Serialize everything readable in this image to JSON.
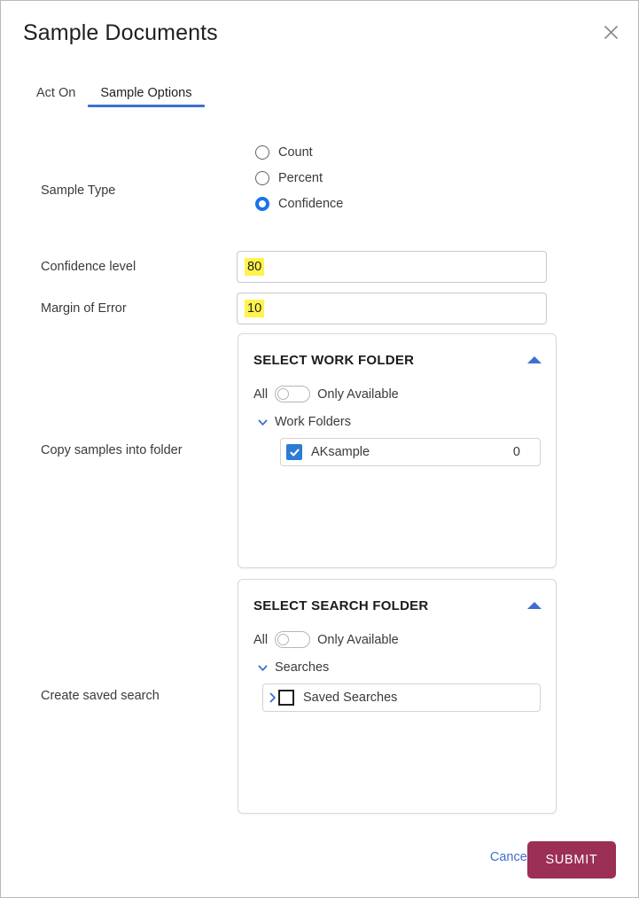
{
  "dialog": {
    "title": "Sample Documents",
    "close_icon": "close-icon"
  },
  "tabs": [
    {
      "label": "Act On",
      "active": false
    },
    {
      "label": "Sample Options",
      "active": true
    }
  ],
  "sample_type": {
    "label": "Sample Type",
    "options": [
      {
        "label": "Count",
        "selected": false
      },
      {
        "label": "Percent",
        "selected": false
      },
      {
        "label": "Confidence",
        "selected": true
      }
    ]
  },
  "confidence_level": {
    "label": "Confidence level",
    "value": "80"
  },
  "margin_of_error": {
    "label": "Margin of Error",
    "value": "10"
  },
  "work_folder": {
    "row_label": "Copy samples into folder",
    "panel_title": "SELECT WORK FOLDER",
    "collapse_icon": "caret-up-icon",
    "toggle_left_label": "All",
    "toggle_right_label": "Only Available",
    "toggle_state": "All",
    "tree_parent": "Work Folders",
    "tree_parent_icon": "chevron-down-icon",
    "child": {
      "label": "AKsample",
      "count": "0",
      "checked": true
    }
  },
  "search_folder": {
    "row_label": "Create saved search",
    "panel_title": "SELECT SEARCH FOLDER",
    "collapse_icon": "caret-up-icon",
    "toggle_left_label": "All",
    "toggle_right_label": "Only Available",
    "toggle_state": "All",
    "tree_parent": "Searches",
    "tree_parent_icon": "chevron-down-icon",
    "child": {
      "label": "Saved Searches",
      "expand_icon": "chevron-right-icon",
      "checked": false
    }
  },
  "footer": {
    "cancel_label": "Cancel",
    "submit_label": "SUBMIT"
  },
  "colors": {
    "accent_blue": "#3d6fd0",
    "checkbox_blue": "#2b7cd3",
    "radio_blue": "#1a73e8",
    "submit_maroon": "#9b2f55",
    "highlight_yellow": "#fff34d"
  }
}
